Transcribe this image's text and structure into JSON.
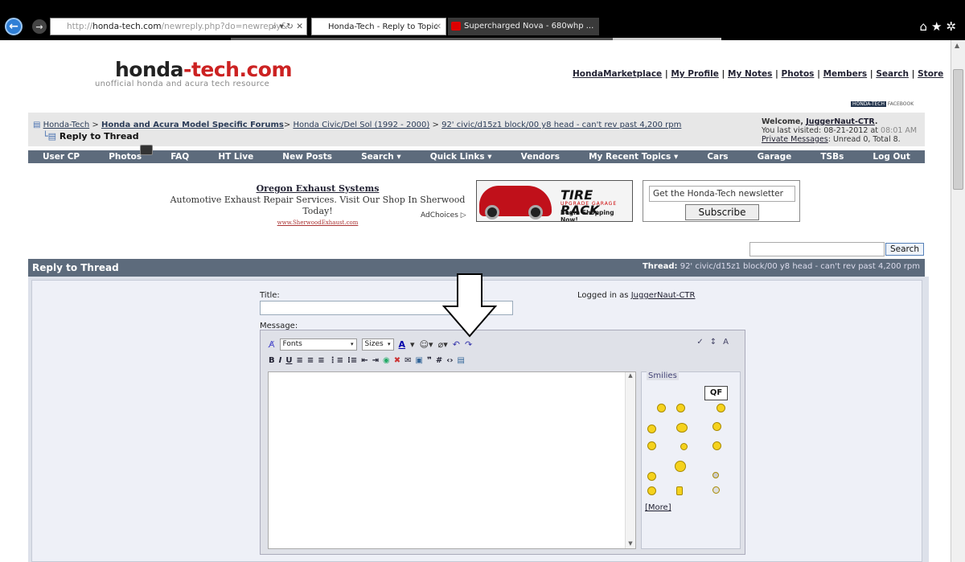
{
  "browser": {
    "address": {
      "prefix": "http://",
      "domain": "honda-tech.com",
      "path": "/newreply.php?do=newreply&",
      "controls": "⌕ ▾ ↻ ✕"
    },
    "tabs": [
      {
        "label": "Honda-Tech - Reply to Topic"
      },
      {
        "label": "Supercharged Nova - 680whp ..."
      }
    ]
  },
  "site": {
    "logo_left": "honda",
    "logo_sep": "-",
    "logo_right": "tech.com",
    "tagline": "unofficial honda and acura tech resource",
    "top_links": [
      "HondaMarketplace",
      "My Profile",
      "My Notes",
      "Photos",
      "Members",
      "Search",
      "Store"
    ],
    "badge_left": "HONDA-TECH",
    "badge_right": "FACEBOOK"
  },
  "breadcrumb": {
    "home": "Honda-Tech",
    "forum": "Honda and Acura Model Specific Forums",
    "subforum": "Honda Civic/Del Sol (1992 - 2000)",
    "thread": "92' civic/d15z1 block/00 y8 head - can't rev past 4,200 rpm",
    "current": "Reply to Thread",
    "sep": ">"
  },
  "welcome": {
    "prefix": "Welcome,",
    "user": "JuggerNaut-CTR",
    "last_visited_label": "You last visited: 08-21-2012 at",
    "last_visited_time": "08:01 AM",
    "pm_link": "Private Messages",
    "pm_status": ": Unread 0, Total 8."
  },
  "navbar": [
    "User CP",
    "Photos",
    "FAQ",
    "HT Live",
    "New Posts",
    "Search ▾",
    "Quick Links ▾",
    "Vendors",
    "My Recent Topics ▾",
    "Cars",
    "Garage",
    "TSBs",
    "Log Out"
  ],
  "ads": {
    "text_title": "Oregon Exhaust Systems",
    "text_body": "Automotive Exhaust Repair Services. Visit Our Shop In Sherwood Today!",
    "text_url": "www.SherwoodExhaust.com",
    "adchoices": "AdChoices ▷",
    "tirerack_brand": "TIRE RACK",
    "tirerack_sub": "UPGRADE GARAGE",
    "tirerack_cta": "Begin Shopping Now!",
    "newsletter_placeholder": "Get the Honda-Tech newsletter",
    "newsletter_button": "Subscribe"
  },
  "search": {
    "button": "Search"
  },
  "reply": {
    "header": "Reply to Thread",
    "thread_label": "Thread:",
    "thread_title": "92' civic/d15z1 block/00 y8 head - can't rev past 4,200 rpm",
    "title_label": "Title:",
    "logged_in_label": "Logged in as",
    "logged_in_user": "JuggerNaut-CTR",
    "message_label": "Message:",
    "font_select": "Fonts",
    "size_select": "Sizes",
    "smilies_title": "Smilies",
    "smilies_more": "[More]",
    "qf_label": "QF"
  },
  "colors": {
    "navbar": "#5d6b7c",
    "link": "#223355",
    "logo_accent": "#cc2222"
  }
}
